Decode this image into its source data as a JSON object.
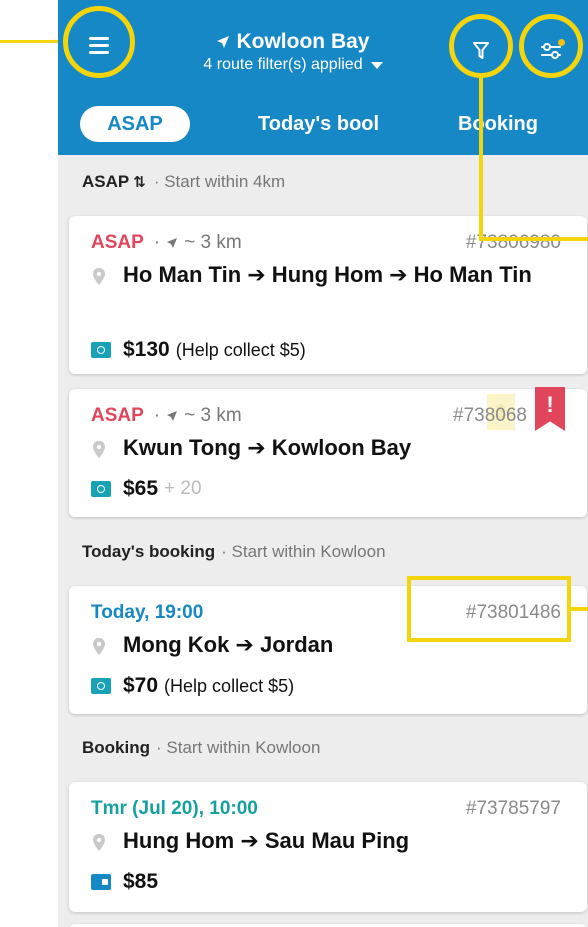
{
  "header": {
    "location": "Kowloon Bay",
    "filter_summary": "4 route filter(s) applied"
  },
  "tabs": [
    "ASAP",
    "Today's bool",
    "Booking"
  ],
  "sections": {
    "asap": {
      "title": "ASAP",
      "subtitle": "· Start within 4km"
    },
    "today": {
      "title": "Today's booking",
      "subtitle": "· Start within Kowloon"
    },
    "booking": {
      "title": "Booking",
      "subtitle": "· Start within Kowloon"
    }
  },
  "orders": [
    {
      "tag": "ASAP",
      "dist_prefix": "·",
      "distance": "~ 3 km",
      "id": "#73806980",
      "route": "Ho Man Tin ➔ Hung Hom ➔ Ho Man Tin",
      "price": "$130",
      "note": "(Help collect $5)",
      "extra": ""
    },
    {
      "tag": "ASAP",
      "dist_prefix": "·",
      "distance": "~ 3 km",
      "id": "#738068",
      "route": "Kwun Tong ➔ Kowloon Bay",
      "price": "$65",
      "note": "",
      "extra": "+ 20",
      "flag": "!"
    },
    {
      "tag": "Today, 19:00",
      "id": "#73801486",
      "route": "Mong Kok ➔ Jordan",
      "price": "$70",
      "note": "(Help collect $5)",
      "extra": ""
    },
    {
      "tag": "Tmr (Jul 20), 10:00",
      "id": "#73785797",
      "route": "Hung Hom ➔ Sau Mau Ping",
      "price": "$85",
      "note": "",
      "extra": ""
    }
  ],
  "colors": {
    "primary": "#1788c6",
    "asap": "#e2465c",
    "teal": "#17a0a0",
    "highlight": "#f4d40a"
  }
}
